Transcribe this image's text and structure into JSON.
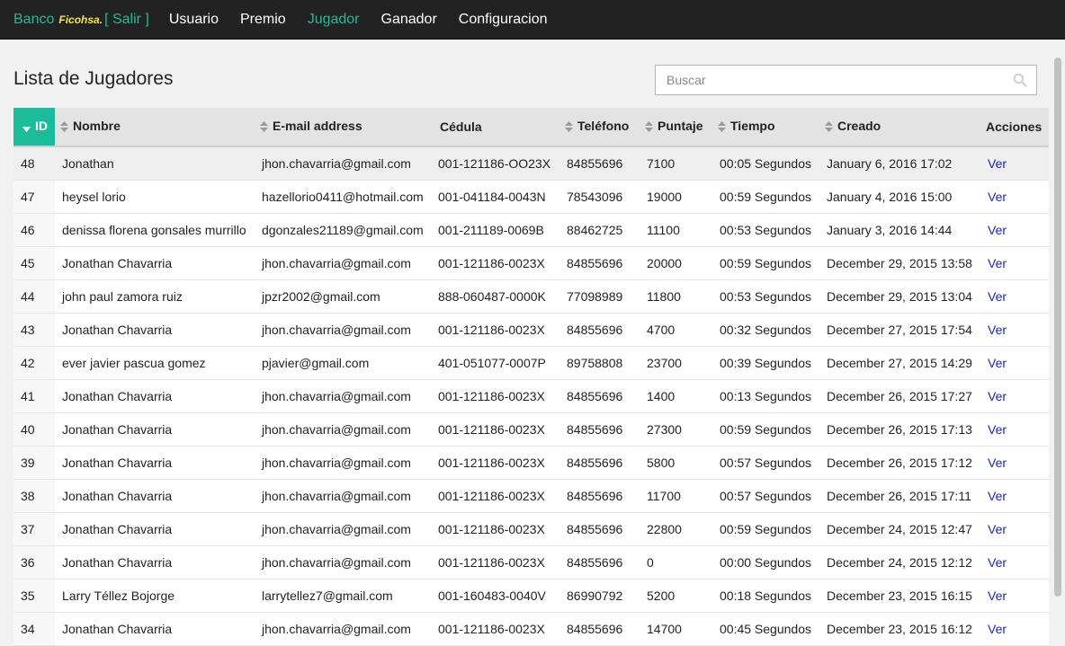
{
  "brand": {
    "part1": "Banco",
    "part2": "Ficohsa.",
    "part3": "[ Salir ]"
  },
  "nav": [
    {
      "label": "Usuario",
      "active": false
    },
    {
      "label": "Premio",
      "active": false
    },
    {
      "label": "Jugador",
      "active": true
    },
    {
      "label": "Ganador",
      "active": false
    },
    {
      "label": "Configuracion",
      "active": false
    }
  ],
  "page": {
    "title": "Lista de Jugadores"
  },
  "search": {
    "placeholder": "Buscar"
  },
  "table": {
    "headers": {
      "id": "ID",
      "nombre": "Nombre",
      "email": "E-mail address",
      "cedula": "Cédula",
      "telefono": "Teléfono",
      "puntaje": "Puntaje",
      "tiempo": "Tiempo",
      "creado": "Creado",
      "acciones": "Acciones"
    },
    "action_label": "Ver",
    "rows": [
      {
        "id": "48",
        "nombre": "Jonathan",
        "email": "jhon.chavarria@gmail.com",
        "cedula": "001-121186-OO23X",
        "telefono": "84855696",
        "puntaje": "7100",
        "tiempo": "00:05 Segundos",
        "creado": "January 6, 2016 17:02"
      },
      {
        "id": "47",
        "nombre": "heysel lorio",
        "email": "hazellorio0411@hotmail.com",
        "cedula": "001-041184-0043N",
        "telefono": "78543096",
        "puntaje": "19000",
        "tiempo": "00:59 Segundos",
        "creado": "January 4, 2016 15:00"
      },
      {
        "id": "46",
        "nombre": "denissa florena gonsales murrillo",
        "email": "dgonzales21189@gmail.com",
        "cedula": "001-211189-0069B",
        "telefono": "88462725",
        "puntaje": "11100",
        "tiempo": "00:53 Segundos",
        "creado": "January 3, 2016 14:44"
      },
      {
        "id": "45",
        "nombre": "Jonathan Chavarria",
        "email": "jhon.chavarria@gmail.com",
        "cedula": "001-121186-0023X",
        "telefono": "84855696",
        "puntaje": "20000",
        "tiempo": "00:59 Segundos",
        "creado": "December 29, 2015 13:58"
      },
      {
        "id": "44",
        "nombre": "john paul zamora ruiz",
        "email": "jpzr2002@gmail.com",
        "cedula": "888-060487-0000K",
        "telefono": "77098989",
        "puntaje": "11800",
        "tiempo": "00:53 Segundos",
        "creado": "December 29, 2015 13:04"
      },
      {
        "id": "43",
        "nombre": "Jonathan Chavarria",
        "email": "jhon.chavarria@gmail.com",
        "cedula": "001-121186-0023X",
        "telefono": "84855696",
        "puntaje": "4700",
        "tiempo": "00:32 Segundos",
        "creado": "December 27, 2015 17:54"
      },
      {
        "id": "42",
        "nombre": "ever javier pascua gomez",
        "email": "pjavier@gmail.com",
        "cedula": "401-051077-0007P",
        "telefono": "89758808",
        "puntaje": "23700",
        "tiempo": "00:39 Segundos",
        "creado": "December 27, 2015 14:29"
      },
      {
        "id": "41",
        "nombre": "Jonathan Chavarria",
        "email": "jhon.chavarria@gmail.com",
        "cedula": "001-121186-0023X",
        "telefono": "84855696",
        "puntaje": "1400",
        "tiempo": "00:13 Segundos",
        "creado": "December 26, 2015 17:27"
      },
      {
        "id": "40",
        "nombre": "Jonathan Chavarria",
        "email": "jhon.chavarria@gmail.com",
        "cedula": "001-121186-0023X",
        "telefono": "84855696",
        "puntaje": "27300",
        "tiempo": "00:59 Segundos",
        "creado": "December 26, 2015 17:13"
      },
      {
        "id": "39",
        "nombre": "Jonathan Chavarria",
        "email": "jhon.chavarria@gmail.com",
        "cedula": "001-121186-0023X",
        "telefono": "84855696",
        "puntaje": "5800",
        "tiempo": "00:57 Segundos",
        "creado": "December 26, 2015 17:12"
      },
      {
        "id": "38",
        "nombre": "Jonathan Chavarria",
        "email": "jhon.chavarria@gmail.com",
        "cedula": "001-121186-0023X",
        "telefono": "84855696",
        "puntaje": "11700",
        "tiempo": "00:57 Segundos",
        "creado": "December 26, 2015 17:11"
      },
      {
        "id": "37",
        "nombre": "Jonathan Chavarria",
        "email": "jhon.chavarria@gmail.com",
        "cedula": "001-121186-0023X",
        "telefono": "84855696",
        "puntaje": "22800",
        "tiempo": "00:59 Segundos",
        "creado": "December 24, 2015 12:47"
      },
      {
        "id": "36",
        "nombre": "Jonathan Chavarria",
        "email": "jhon.chavarria@gmail.com",
        "cedula": "001-121186-0023X",
        "telefono": "84855696",
        "puntaje": "0",
        "tiempo": "00:00 Segundos",
        "creado": "December 24, 2015 12:12"
      },
      {
        "id": "35",
        "nombre": "Larry Téllez Bojorge",
        "email": "larrytellez7@gmail.com",
        "cedula": "001-160483-0040V",
        "telefono": "86990792",
        "puntaje": "5200",
        "tiempo": "00:18 Segundos",
        "creado": "December 23, 2015 16:15"
      },
      {
        "id": "34",
        "nombre": "Jonathan Chavarria",
        "email": "jhon.chavarria@gmail.com",
        "cedula": "001-121186-0023X",
        "telefono": "84855696",
        "puntaje": "14700",
        "tiempo": "00:45 Segundos",
        "creado": "December 23, 2015 16:12"
      }
    ]
  },
  "colors": {
    "accent": "#1abc9c",
    "navbar": "#222222",
    "link": "#1a25b8",
    "brand_yellow": "#f1e64a"
  }
}
